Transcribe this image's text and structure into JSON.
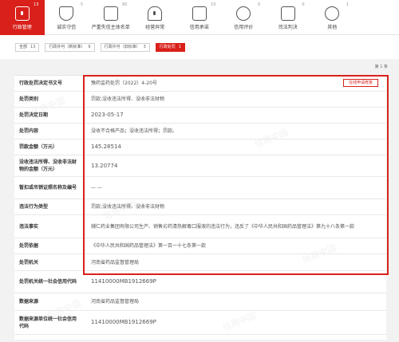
{
  "tabs": [
    {
      "label": "行政管理",
      "count": "13",
      "icon": "document-icon",
      "active": true
    },
    {
      "label": "诚实守信",
      "count": "5",
      "icon": "shield-icon",
      "active": false
    },
    {
      "label": "严重失信主体名单",
      "count": "80",
      "icon": "car-icon",
      "active": false
    },
    {
      "label": "经营异常",
      "count": "",
      "icon": "alarm-icon",
      "active": false
    },
    {
      "label": "信用承诺",
      "count": "10",
      "icon": "promise-icon",
      "active": false
    },
    {
      "label": "信用评价",
      "count": "0",
      "icon": "rating-icon",
      "active": false
    },
    {
      "label": "司法判决",
      "count": "0",
      "icon": "judgement-icon",
      "active": false
    },
    {
      "label": "其他",
      "count": "1",
      "icon": "other-icon",
      "active": false
    }
  ],
  "filters": [
    {
      "label": "全部",
      "count": "13",
      "active": false
    },
    {
      "label": "行政许可（新标准）",
      "count": "9",
      "active": false
    },
    {
      "label": "行政许可（旧标准）",
      "count": "3",
      "active": false
    },
    {
      "label": "行政处罚",
      "count": "1",
      "active": true
    }
  ],
  "pager": {
    "text": "第 1 条"
  },
  "apply_button": "在线申请修复",
  "watermark": "信用中国",
  "rows": [
    {
      "key": "行政处罚决定书文号",
      "value": "豫药监药处罚〔2022〕4-20号"
    },
    {
      "key": "处罚类别",
      "value": "罚款;没收违法所得、没收非法财物"
    },
    {
      "key": "处罚决定日期",
      "value": "2023-05-17"
    },
    {
      "key": "处罚内容",
      "value": "没收不合格产品；没收违法所得；罚款。"
    },
    {
      "key": "罚款金额（万元）",
      "value": "145.28514"
    },
    {
      "key": "没收违法所得、没收非法财物的金额（万元）",
      "value": "13.20774"
    },
    {
      "key": "暂扣或吊销证照名称及编号",
      "value": "— —"
    },
    {
      "key": "违法行为类型",
      "value": "罚款;没收违法所得、没收非法财物"
    },
    {
      "key": "违法事实",
      "value": "辅仁药业集团有限公司生产、销售劣药清热解毒口服液的违法行为，违反了《中华人民共和国药品管理法》第九十八条第一款"
    },
    {
      "key": "处罚依据",
      "value": "《中华人民共和国药品管理法》第一百一十七条第一款"
    },
    {
      "key": "处罚机关",
      "value": "河南省药品监督管理局"
    },
    {
      "key": "处罚机关统一社会信用代码",
      "value": "11410000MB1912669P"
    },
    {
      "key": "数据来源",
      "value": "河南省药品监督管理局"
    },
    {
      "key": "数据来源单位统一社会信用代码",
      "value": "11410000MB1912669P"
    }
  ]
}
